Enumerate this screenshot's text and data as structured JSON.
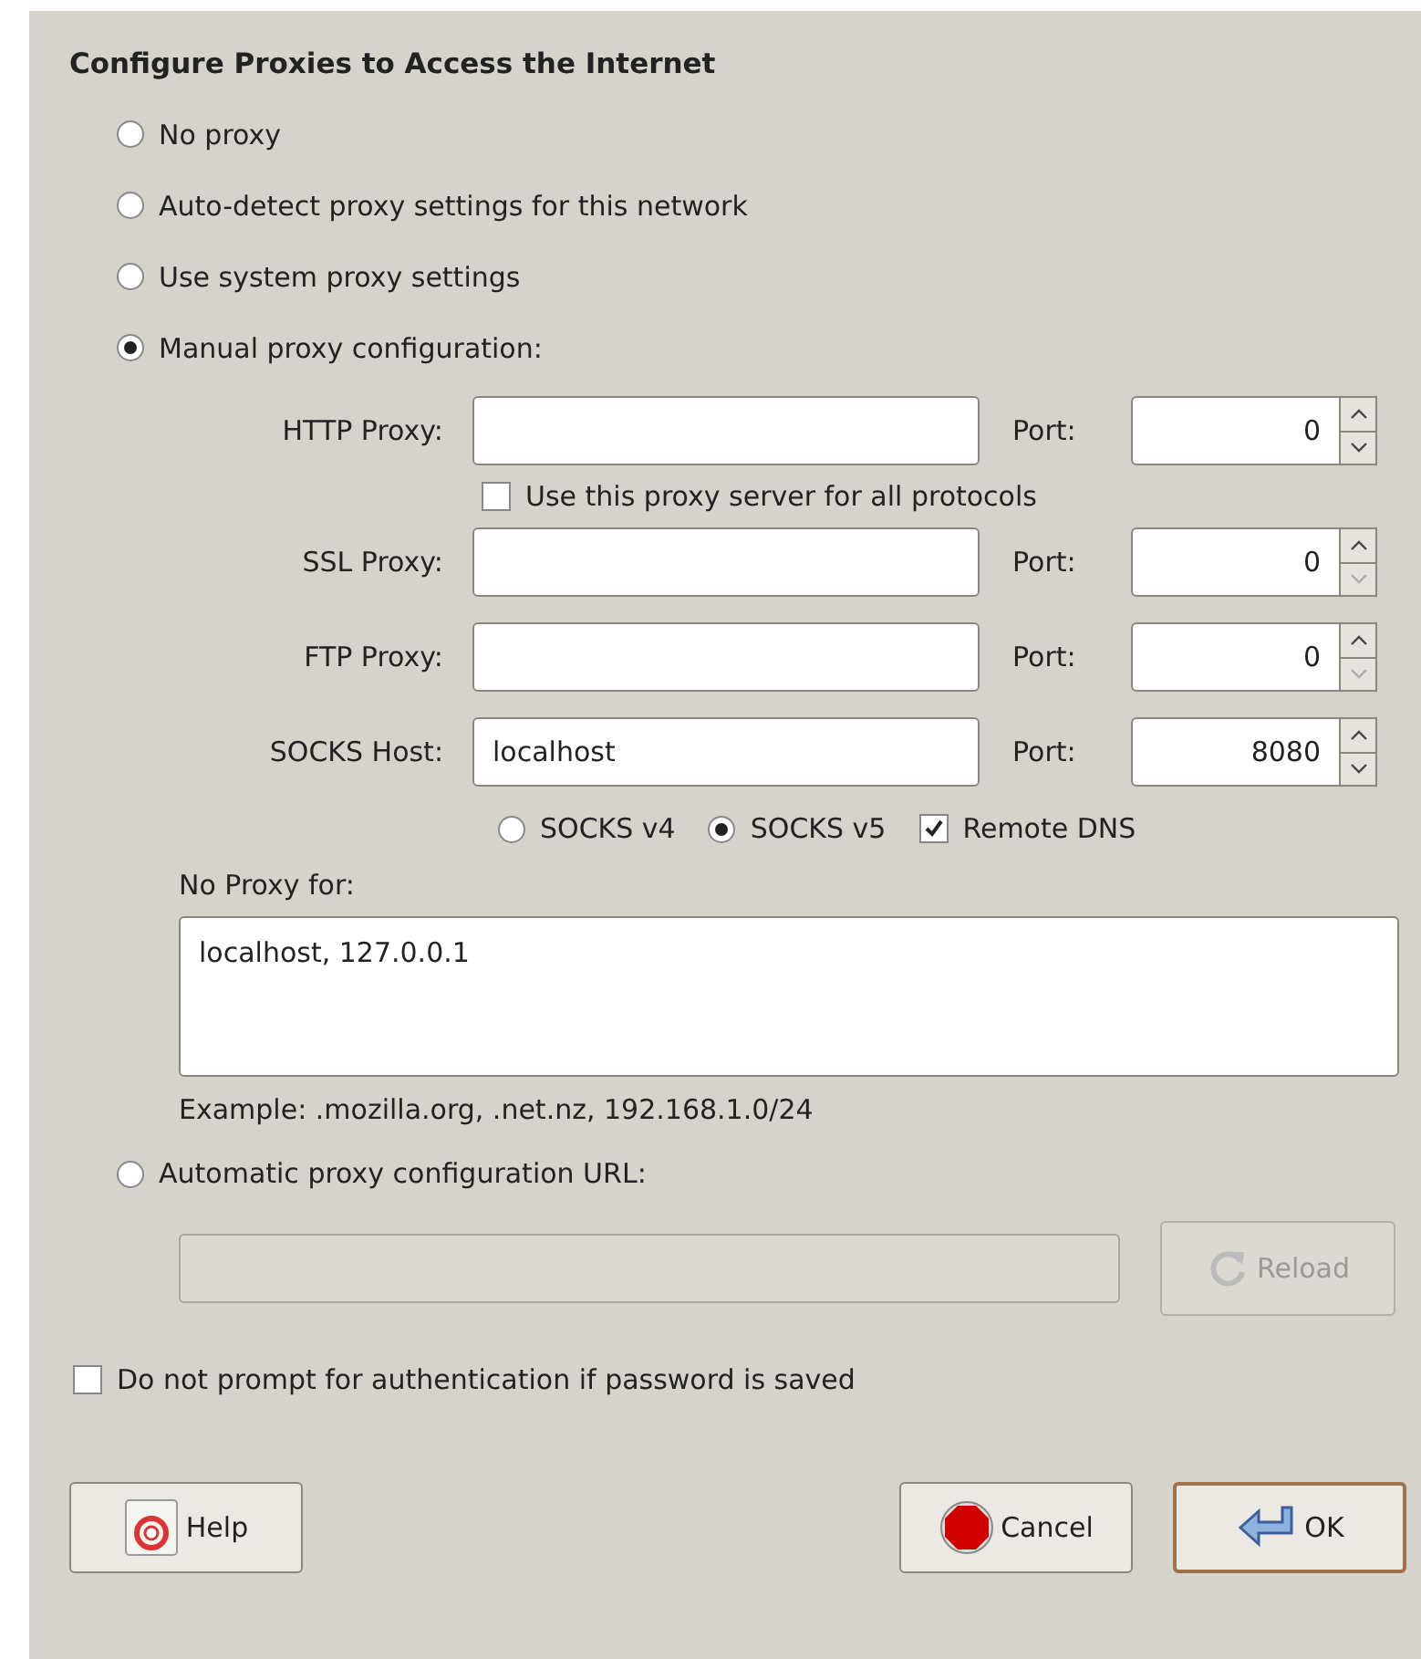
{
  "dialog": {
    "title": "Configure Proxies to Access the Internet",
    "modes": [
      {
        "label": "No proxy",
        "selected": false
      },
      {
        "label": "Auto-detect proxy settings for this network",
        "selected": false
      },
      {
        "label": "Use system proxy settings",
        "selected": false
      },
      {
        "label": "Manual proxy configuration:",
        "selected": true
      }
    ],
    "proxies": [
      {
        "label": "HTTP Proxy:",
        "port_label": "Port:",
        "port": "0",
        "down_enabled": true
      },
      {
        "label": "SSL Proxy:",
        "port_label": "Port:",
        "port": "0",
        "down_enabled": false
      },
      {
        "label": "FTP Proxy:",
        "port_label": "Port:",
        "port": "0",
        "down_enabled": false
      },
      {
        "label": "SOCKS Host:",
        "value": "localhost",
        "port_label": "Port:",
        "port": "8080",
        "down_enabled": true
      }
    ],
    "share_all": {
      "label": "Use this proxy server for all protocols",
      "checked": false
    },
    "socks_versions": [
      {
        "label": "SOCKS v4",
        "selected": false
      },
      {
        "label": "SOCKS v5",
        "selected": true
      }
    ],
    "remote_dns": {
      "label": "Remote DNS",
      "checked": true
    },
    "no_proxy": {
      "label": "No Proxy for:",
      "value": "localhost, 127.0.0.1",
      "example": "Example: .mozilla.org, .net.nz, 192.168.1.0/24"
    },
    "auto_url": {
      "label": "Automatic proxy configuration URL:",
      "selected": false,
      "disabled": true,
      "reload": {
        "label": "Reload",
        "disabled": true
      }
    },
    "no_prompt": {
      "label": "Do not prompt for authentication if password is saved",
      "checked": false
    },
    "buttons": [
      {
        "kind": "help",
        "label": "Help",
        "focused": false
      },
      {
        "kind": "cancel",
        "label": "Cancel",
        "focused": false
      },
      {
        "kind": "ok",
        "label": "OK",
        "focused": true
      }
    ]
  }
}
